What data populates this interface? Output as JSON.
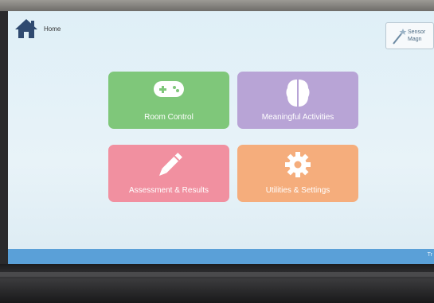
{
  "header": {
    "home_label": "Home",
    "signout_label": "Sensor\nMagn"
  },
  "tiles": [
    {
      "label": "Room Control",
      "icon": "gamepad-icon",
      "color": "#7fc77a"
    },
    {
      "label": "Meaningful Activities",
      "icon": "brain-icon",
      "color": "#b8a4d6"
    },
    {
      "label": "Assessment & Results",
      "icon": "pencil-icon",
      "color": "#f190a0"
    },
    {
      "label": "Utilities & Settings",
      "icon": "gear-icon",
      "color": "#f5ad7c"
    }
  ],
  "footer": {
    "color": "#5aa0d8",
    "corner_text": "Tr"
  }
}
